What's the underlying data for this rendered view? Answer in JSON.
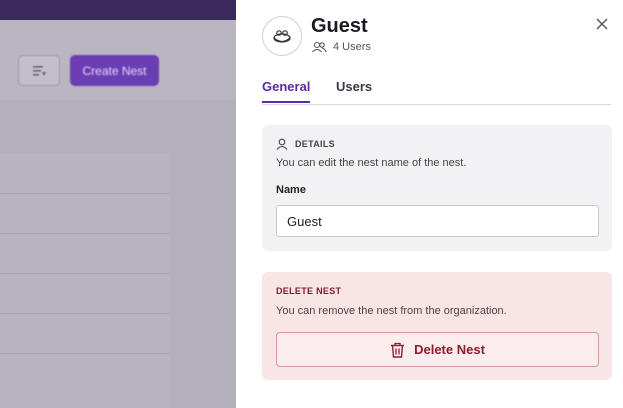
{
  "background": {
    "create_button_label": "Create Nest"
  },
  "drawer": {
    "title": "Guest",
    "users_count": "4 Users",
    "tabs": [
      {
        "label": "General",
        "active": true
      },
      {
        "label": "Users",
        "active": false
      }
    ],
    "details": {
      "heading": "DETAILS",
      "description": "You can edit the nest name of the nest.",
      "name_label": "Name",
      "name_value": "Guest"
    },
    "delete": {
      "heading": "DELETE NEST",
      "description": "You can remove the nest from the organization.",
      "button_label": "Delete Nest"
    }
  },
  "colors": {
    "accent": "#5b2aa6",
    "danger": "#8b1f2f",
    "danger_bg": "#f8e6e7"
  },
  "icons": {
    "avatar": "nest-icon",
    "users": "users-icon",
    "close": "close-icon",
    "details": "user-icon",
    "delete": "trash-icon",
    "filter": "filter-icon"
  }
}
